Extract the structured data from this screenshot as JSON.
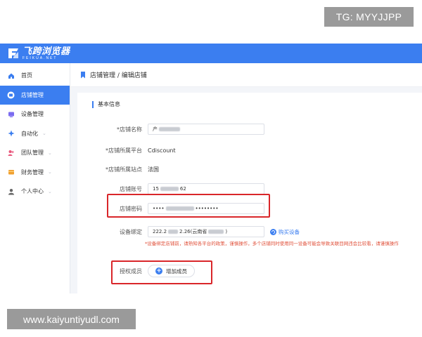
{
  "watermarks": {
    "top_right": "TG: MYYJJPP",
    "bottom_left": "www.kaiyuntiyudl.com"
  },
  "app": {
    "logo_cn": "飞跨浏览器",
    "logo_en": "FEIKUA.NET",
    "accent": "#3b7ef0"
  },
  "sidebar": {
    "items": [
      {
        "label": "首页",
        "icon": "home-icon",
        "has_chevron": false
      },
      {
        "label": "店铺管理",
        "icon": "shop-icon",
        "has_chevron": false,
        "active": true
      },
      {
        "label": "设备管理",
        "icon": "device-icon",
        "has_chevron": false
      },
      {
        "label": "自动化",
        "icon": "automation-icon",
        "has_chevron": true
      },
      {
        "label": "团队管理",
        "icon": "team-icon",
        "has_chevron": true
      },
      {
        "label": "财务管理",
        "icon": "finance-icon",
        "has_chevron": true
      },
      {
        "label": "个人中心",
        "icon": "user-icon",
        "has_chevron": true
      }
    ]
  },
  "breadcrumb": "店铺管理 / 编辑店铺",
  "form": {
    "section_title": "基本信息",
    "shop_name": {
      "label": "*店铺名称",
      "value": "产"
    },
    "platform": {
      "label": "*店铺所属平台",
      "value": "Cdiscount"
    },
    "site": {
      "label": "*店铺所属站点",
      "value": "法国"
    },
    "account": {
      "label": "店铺账号",
      "value_prefix": "15",
      "value_suffix": "62"
    },
    "password": {
      "label": "店铺密码",
      "value_prefix": "••••",
      "value_suffix": "••••••••"
    },
    "device": {
      "label": "设备绑定",
      "value_prefix": "222.2",
      "value_suffix": "2.26(云南省",
      "value_tail": ")",
      "link": "购买设备"
    },
    "notice": "*设备绑定店铺前，请熟知各平台的政策，谨慎操作，多个店铺同时使用同一设备可能会导致关联目网违会比较看，请谨慎操作",
    "members": {
      "label": "授权成员",
      "button": "增加成员"
    }
  }
}
